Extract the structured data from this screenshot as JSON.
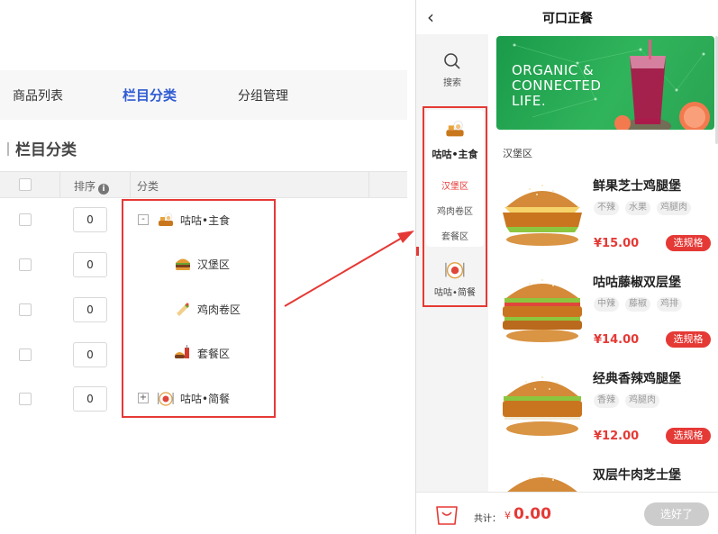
{
  "admin": {
    "tabs": [
      "商品列表",
      "栏目分类",
      "分组管理"
    ],
    "active_tab": "栏目分类",
    "section_title": "栏目分类",
    "table_headers": {
      "order": "排序",
      "category": "分类"
    },
    "rows": [
      {
        "order": "0",
        "toggle": "-",
        "icon": "chef-food-icon",
        "name": "咕咕•主食"
      },
      {
        "order": "0",
        "toggle": "",
        "icon": "burger-icon",
        "name": "汉堡区"
      },
      {
        "order": "0",
        "toggle": "",
        "icon": "wrap-icon",
        "name": "鸡肉卷区"
      },
      {
        "order": "0",
        "toggle": "",
        "icon": "combo-meal-icon",
        "name": "套餐区"
      },
      {
        "order": "0",
        "toggle": "+",
        "icon": "light-meal-icon",
        "name": "咕咕•简餐"
      }
    ]
  },
  "phone": {
    "title": "可口正餐",
    "search_label": "搜索",
    "sidebar": {
      "main_category": "咕咕•主食",
      "subcategories": [
        "汉堡区",
        "鸡肉卷区",
        "套餐区"
      ],
      "active_sub": "汉堡区",
      "second_category": "咕咕•简餐"
    },
    "banner": {
      "lines": [
        "ORGANIC &",
        "CONNECTED",
        "LIFE."
      ]
    },
    "section_label": "汉堡区",
    "products": [
      {
        "name": "鲜果芝士鸡腿堡",
        "tags": [
          "不辣",
          "水果",
          "鸡腿肉"
        ],
        "price": "¥15.00",
        "button": "选规格"
      },
      {
        "name": "咕咕藤椒双层堡",
        "tags": [
          "中辣",
          "藤椒",
          "鸡排"
        ],
        "price": "¥14.00",
        "button": "选规格"
      },
      {
        "name": "经典香辣鸡腿堡",
        "tags": [
          "香辣",
          "鸡腿肉"
        ],
        "price": "¥12.00",
        "button": "选规格"
      },
      {
        "name": "双层牛肉芝士堡",
        "tags": [],
        "price": "",
        "button": ""
      }
    ],
    "footer": {
      "total_label": "共计：",
      "currency": "¥",
      "total": "0.00",
      "done_button": "选好了"
    }
  },
  "colors": {
    "accent_blue": "#2f5bd3",
    "accent_red": "#e53935",
    "banner_green": "#30b45b"
  }
}
